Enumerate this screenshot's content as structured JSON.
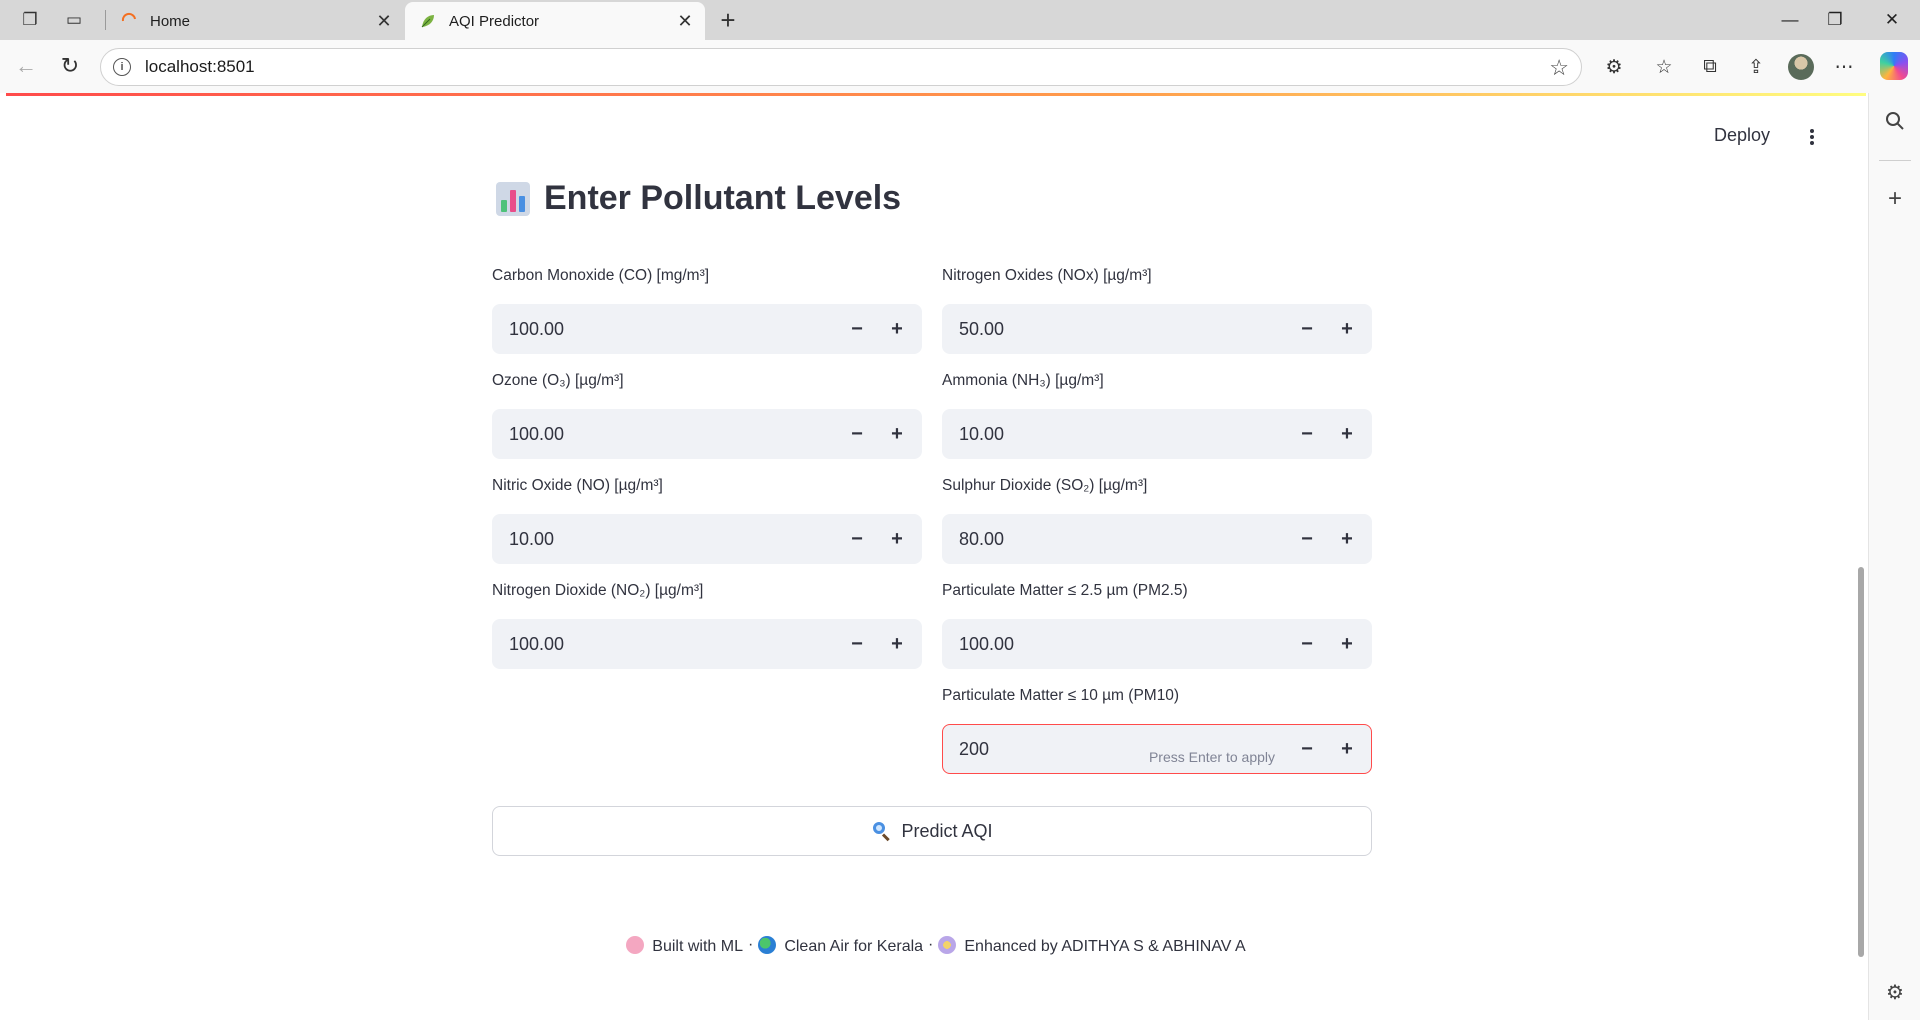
{
  "browser": {
    "tabs": [
      {
        "title": "Home"
      },
      {
        "title": "AQI Predictor"
      }
    ],
    "url": "localhost:8501"
  },
  "app": {
    "deploy_label": "Deploy",
    "heading": "Enter Pollutant Levels",
    "fields": {
      "co": {
        "label": "Carbon Monoxide (CO) [mg/m³]",
        "value": "100.00"
      },
      "nox": {
        "label": "Nitrogen Oxides (NOx) [µg/m³]",
        "value": "50.00"
      },
      "o3": {
        "label": "Ozone (O₃) [µg/m³]",
        "value": "100.00"
      },
      "nh3": {
        "label": "Ammonia (NH₃) [µg/m³]",
        "value": "10.00"
      },
      "no": {
        "label": "Nitric Oxide (NO) [µg/m³]",
        "value": "10.00"
      },
      "so2": {
        "label": "Sulphur Dioxide (SO₂) [µg/m³]",
        "value": "80.00"
      },
      "no2": {
        "label": "Nitrogen Dioxide (NO₂) [µg/m³]",
        "value": "100.00"
      },
      "pm25": {
        "label": "Particulate Matter ≤ 2.5 µm (PM2.5)",
        "value": "100.00"
      },
      "pm10": {
        "label": "Particulate Matter ≤ 10 µm (PM10)",
        "value": "200",
        "hint": "Press Enter to apply"
      }
    },
    "predict_label": "Predict AQI",
    "footer": {
      "part1": "Built with ML",
      "part2": "Clean Air for Kerala",
      "part3": "Enhanced by ADITHYA S & ABHINAV A",
      "separator": "·"
    }
  },
  "colors": {
    "accent": "#ff4b4b",
    "input_bg": "#f0f2f6",
    "text": "#31333f"
  }
}
